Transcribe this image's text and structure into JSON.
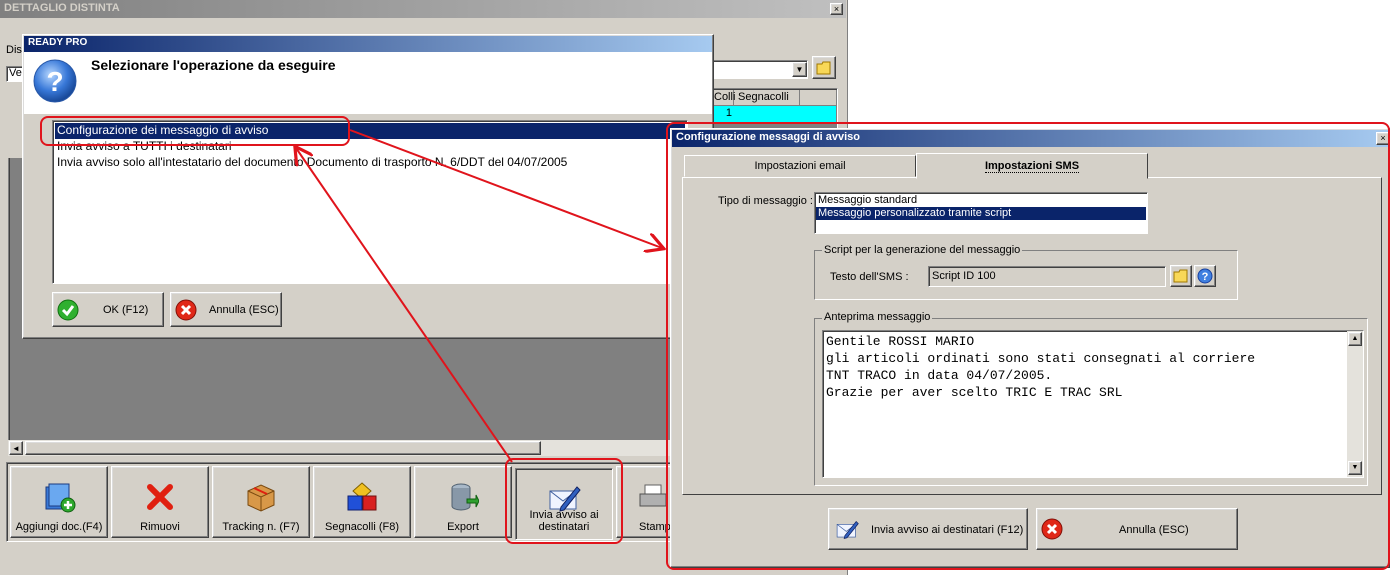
{
  "background_window": {
    "title": "DETTAGLIO DISTINTA",
    "close_glyph": "×",
    "fragment_dis": "Dis",
    "fragment_ve": "Ve",
    "grid_headers": [
      "Colli",
      "Segnacolli"
    ],
    "grid_first_cell": "1",
    "combo_arrow": "▼",
    "scroll_left": "◄"
  },
  "toolbar": {
    "buttons": [
      {
        "label": "Aggiungi doc.(F4)",
        "icon": "add-document-icon"
      },
      {
        "label": "Rimuovi",
        "icon": "red-x-icon"
      },
      {
        "label": "Tracking n. (F7)",
        "icon": "package-icon"
      },
      {
        "label": "Segnacolli (F8)",
        "icon": "shapes-icon"
      },
      {
        "label": "Export",
        "icon": "database-export-icon"
      },
      {
        "label": "Invia avviso ai destinatari",
        "icon": "envelope-pen-icon"
      },
      {
        "label": "Stamp",
        "icon": "printer-icon"
      }
    ]
  },
  "ready_pro_dialog": {
    "title": "READY PRO",
    "prompt": "Selezionare l'operazione da eseguire",
    "options": [
      "Configurazione dei messaggio di avviso",
      "Invia avviso a TUTTI i destinatari",
      "Invia avviso solo all'intestatario del documento Documento di trasporto N. 6/DDT del 04/07/2005"
    ],
    "selected_index": 0,
    "ok_label": "OK (F12)",
    "cancel_label": "Annulla (ESC)"
  },
  "config_dialog": {
    "title": "Configurazione messaggi di avviso",
    "close_glyph": "×",
    "tabs": [
      {
        "label": "Impostazioni email",
        "active": false
      },
      {
        "label": "Impostazioni SMS",
        "active": true
      }
    ],
    "tipo_label": "Tipo di messaggio :",
    "tipo_options": [
      "Messaggio standard",
      "Messaggio personalizzato tramite script"
    ],
    "tipo_selected_index": 1,
    "script_group_label": "Script per la generazione del messaggio",
    "testo_label": "Testo dell'SMS :",
    "testo_value": "Script ID 100",
    "preview_group_label": "Anteprima messaggio",
    "preview_lines": [
      "Gentile ROSSI MARIO",
      "gli articoli ordinati sono stati consegnati al corriere",
      "TNT TRACO in data 04/07/2005.",
      "Grazie per aver scelto TRIC E TRAC SRL"
    ],
    "scroll_up": "▲",
    "scroll_down": "▼",
    "send_label": "Invia avviso ai destinatari (F12)",
    "cancel_label": "Annulla (ESC)"
  },
  "colors": {
    "window_face": "#d4d0c8",
    "selection": "#0a246a",
    "title_gradient_start": "#0a246a",
    "annotation_red": "#e0141c",
    "grid_highlight": "#00ffff"
  }
}
